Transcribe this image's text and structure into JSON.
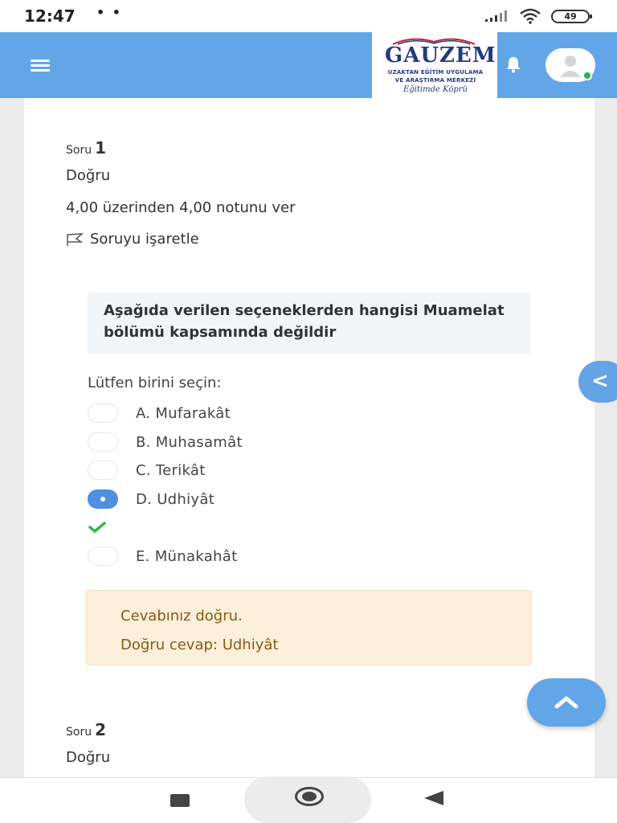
{
  "status_bar": {
    "time": "12:47",
    "dots": "• •",
    "battery": "49"
  },
  "navbar": {
    "logo": {
      "title": "GAUZEM",
      "line1": "UZAKTAN EĞİTİM UYGULAMA",
      "line2": "VE ARAŞTIRMA MERKEZİ",
      "slogan": "Eğitimde Köprü"
    }
  },
  "question1": {
    "label": "Soru",
    "number": "1",
    "state": "Doğru",
    "grade": "4,00 üzerinden 4,00 notunu ver",
    "flag_label": "Soruyu işaretle",
    "text": "Aşağıda verilen seçeneklerden hangisi Muamelat bölümü kapsamında değildir",
    "prompt": "Lütfen birini seçin:",
    "options": [
      {
        "label": "A. Mufarakât",
        "checked": false
      },
      {
        "label": "B. Muhasamât",
        "checked": false
      },
      {
        "label": "C. Terikât",
        "checked": false
      },
      {
        "label": "D. Udhiyât",
        "checked": true
      },
      {
        "label": "E. Münakahât",
        "checked": false
      }
    ],
    "feedback": {
      "line1": "Cevabınız doğru.",
      "line2": "Doğru cevap: Udhiyât"
    }
  },
  "question2": {
    "label": "Soru",
    "number": "2",
    "state": "Doğru"
  },
  "colors": {
    "navbar": "#63a6e8",
    "radio_checked": "#4f8fe0",
    "feedback_bg": "#fcefdc",
    "correct_check": "#3cb04a"
  }
}
